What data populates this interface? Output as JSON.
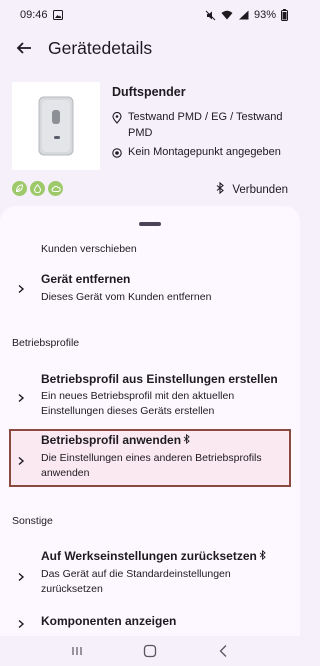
{
  "status_bar": {
    "time": "09:46",
    "battery": "93%"
  },
  "app_bar": {
    "title": "Gerätedetails"
  },
  "device": {
    "name": "Duftspender",
    "location": "Testwand PMD / EG / Testwand PMD",
    "mounting_point": "Kein Montagepunkt angegeben",
    "connection": "Verbunden",
    "badges": [
      "leaf-icon",
      "drop-icon",
      "cloud-icon"
    ]
  },
  "sheet": {
    "partial_item": "Kunden verschieben",
    "remove": {
      "title": "Gerät entfernen",
      "subtitle": "Dieses Gerät vom Kunden entfernen"
    },
    "section_profiles": "Betriebsprofile",
    "create_profile": {
      "title": "Betriebsprofil aus Einstellungen erstellen",
      "subtitle": "Ein neues Betriebsprofil mit den aktuellen Einstellungen dieses Geräts erstellen"
    },
    "apply_profile": {
      "title": "Betriebsprofil anwenden",
      "subtitle": "Die Einstellungen eines anderen Betriebsprofils anwenden"
    },
    "section_other": "Sonstige",
    "factory_reset": {
      "title": "Auf Werkseinstellungen zurücksetzen",
      "subtitle": "Das Gerät auf die Standardeinstellungen zurücksetzen"
    },
    "components": {
      "title": "Komponenten anzeigen"
    }
  },
  "colors": {
    "background": "#f6f0fa",
    "sheet": "#fdf8ff",
    "badge": "#9dc96b",
    "highlight_border": "#8b4a3f",
    "highlight_fill": "#fbe9f2"
  }
}
